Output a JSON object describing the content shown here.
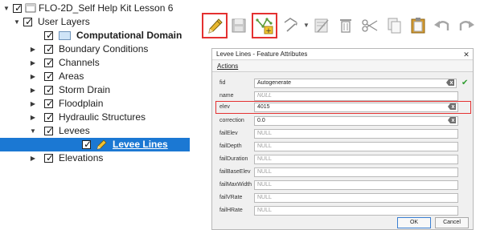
{
  "layer_tree": {
    "rows": [
      {
        "label": "FLO-2D_Self Help Kit Lesson 6"
      },
      {
        "label": "User Layers"
      },
      {
        "label": "Computational Domain"
      },
      {
        "label": "Boundary Conditions"
      },
      {
        "label": "Channels"
      },
      {
        "label": "Areas"
      },
      {
        "label": "Storm Drain"
      },
      {
        "label": "Floodplain"
      },
      {
        "label": "Hydraulic Structures"
      },
      {
        "label": "Levees"
      },
      {
        "label": "Levee Lines"
      },
      {
        "label": "Elevations"
      }
    ]
  },
  "toolbar": {
    "buttons": [
      {
        "icon": "pencil-edit-icon",
        "highlighted": true
      },
      {
        "icon": "save-icon",
        "highlighted": false
      },
      {
        "icon": "add-line-feature-icon",
        "highlighted": true
      },
      {
        "icon": "vertex-tool-icon",
        "highlighted": false
      },
      {
        "icon": "modify-attributes-icon",
        "highlighted": false
      },
      {
        "icon": "delete-icon",
        "highlighted": false
      },
      {
        "icon": "cut-icon",
        "highlighted": false
      },
      {
        "icon": "copy-icon",
        "highlighted": false
      },
      {
        "icon": "paste-icon",
        "highlighted": false
      },
      {
        "icon": "undo-icon",
        "highlighted": false
      },
      {
        "icon": "redo-icon",
        "highlighted": false
      }
    ]
  },
  "dialog": {
    "title": "Levee Lines - Feature Attributes",
    "close_glyph": "✕",
    "menu_actions": "Actions",
    "fields": [
      {
        "label": "fid",
        "value": "Autogenerate"
      },
      {
        "label": "name",
        "value": "NULL"
      },
      {
        "label": "elev",
        "value": "4015"
      },
      {
        "label": "correction",
        "value": "0.0"
      },
      {
        "label": "failElev",
        "value": "NULL"
      },
      {
        "label": "failDepth",
        "value": "NULL"
      },
      {
        "label": "failDuration",
        "value": "NULL"
      },
      {
        "label": "failBaseElev",
        "value": "NULL"
      },
      {
        "label": "failMaxWidth",
        "value": "NULL"
      },
      {
        "label": "failVRate",
        "value": "NULL"
      },
      {
        "label": "failHRate",
        "value": "NULL"
      }
    ],
    "check_glyph": "✔",
    "ok_label": "OK",
    "cancel_label": "Cancel"
  },
  "colors": {
    "selection": "#1b78d3",
    "highlight_border": "#e43131",
    "check_green": "#2e9d2e"
  }
}
